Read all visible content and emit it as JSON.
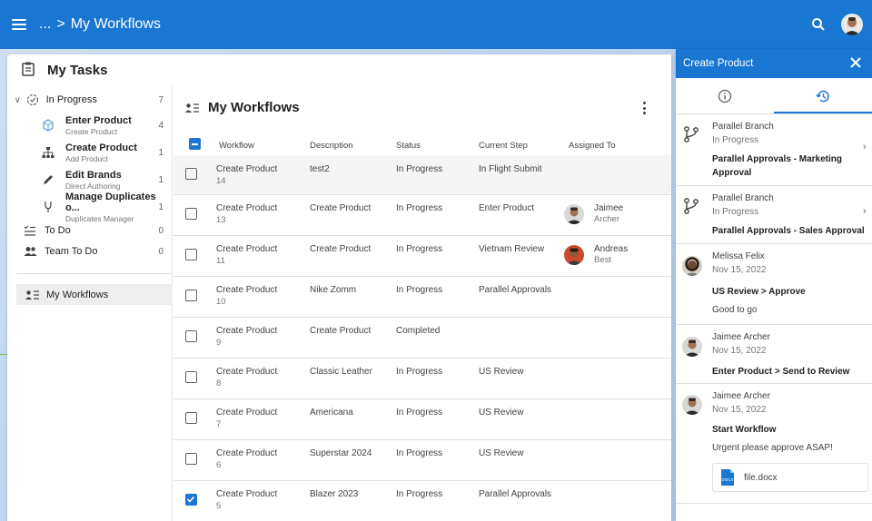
{
  "topbar": {
    "ellipsis": "...",
    "separator": ">",
    "title": "My Workflows"
  },
  "tasks": {
    "title": "My Tasks",
    "in_progress": {
      "label": "In Progress",
      "count": "7"
    },
    "items": [
      {
        "label": "Enter Product",
        "sub": "Create Product",
        "count": "4"
      },
      {
        "label": "Create Product",
        "sub": "Add Product",
        "count": "1"
      },
      {
        "label": "Edit Brands",
        "sub": "Direct Authoring",
        "count": "1"
      },
      {
        "label": "Manage Duplicates o...",
        "sub": "Duplicates Manager",
        "count": "1"
      }
    ],
    "todo": {
      "label": "To Do",
      "count": "0"
    },
    "team_todo": {
      "label": "Team To Do",
      "count": "0"
    },
    "my_workflows": "My Workflows"
  },
  "workflows": {
    "title": "My Workflows",
    "columns": [
      "Workflow",
      "Description",
      "Status",
      "Current Step",
      "Assigned To"
    ],
    "rows": [
      {
        "name": "Create Product",
        "num": "14",
        "desc": "test2",
        "status": "In Progress",
        "step": "In Flight Submit",
        "assignee": "",
        "assignee2": "",
        "checked": false
      },
      {
        "name": "Create Product",
        "num": "13",
        "desc": "Create Product",
        "status": "In Progress",
        "step": "Enter Product",
        "assignee": "Jaimee",
        "assignee2": "Archer",
        "checked": false
      },
      {
        "name": "Create Product",
        "num": "11",
        "desc": "Create Product",
        "status": "In Progress",
        "step": "Vietnam Review",
        "assignee": "Andreas",
        "assignee2": "Best",
        "checked": false
      },
      {
        "name": "Create Product",
        "num": "10",
        "desc": "Nike Zomm",
        "status": "In Progress",
        "step": "Parallel Approvals",
        "assignee": "",
        "assignee2": "",
        "checked": false
      },
      {
        "name": "Create Product",
        "num": "9",
        "desc": "Create Product",
        "status": "Completed",
        "step": "",
        "assignee": "",
        "assignee2": "",
        "checked": false
      },
      {
        "name": "Create Product",
        "num": "8",
        "desc": "Classic Leather",
        "status": "In Progress",
        "step": "US Review",
        "assignee": "",
        "assignee2": "",
        "checked": false
      },
      {
        "name": "Create Product",
        "num": "7",
        "desc": "Americana",
        "status": "In Progress",
        "step": "US Review",
        "assignee": "",
        "assignee2": "",
        "checked": false
      },
      {
        "name": "Create Product",
        "num": "6",
        "desc": "Superstar 2024",
        "status": "In Progress",
        "step": "US Review",
        "assignee": "",
        "assignee2": "",
        "checked": false
      },
      {
        "name": "Create Product",
        "num": "5",
        "desc": "Blazer 2023",
        "status": "In Progress",
        "step": "Parallel Approvals",
        "assignee": "",
        "assignee2": "",
        "checked": true
      }
    ]
  },
  "panel": {
    "title": "Create Product",
    "history": [
      {
        "l1": "Parallel Branch",
        "l2": "In Progress",
        "l3": "Parallel Approvals - Marketing Approval"
      },
      {
        "l1": "Parallel Branch",
        "l2": "In Progress",
        "l3": "Parallel Approvals - Sales Approval"
      },
      {
        "l1": "Melissa Felix",
        "l2": "Nov 15, 2022",
        "l3": "US Review > Approve",
        "l4": "Good to go"
      },
      {
        "l1": "Jaimee Archer",
        "l2": "Nov 15, 2022",
        "l3": "Enter Product > Send to Review"
      },
      {
        "l1": "Jaimee Archer",
        "l2": "Nov 15, 2022",
        "l3": "Start Workflow",
        "l4": "Urgent please approve ASAP!"
      }
    ],
    "file": "file.docx",
    "file_badge": "DOCX"
  },
  "colors": {
    "primary": "#1976d2"
  }
}
